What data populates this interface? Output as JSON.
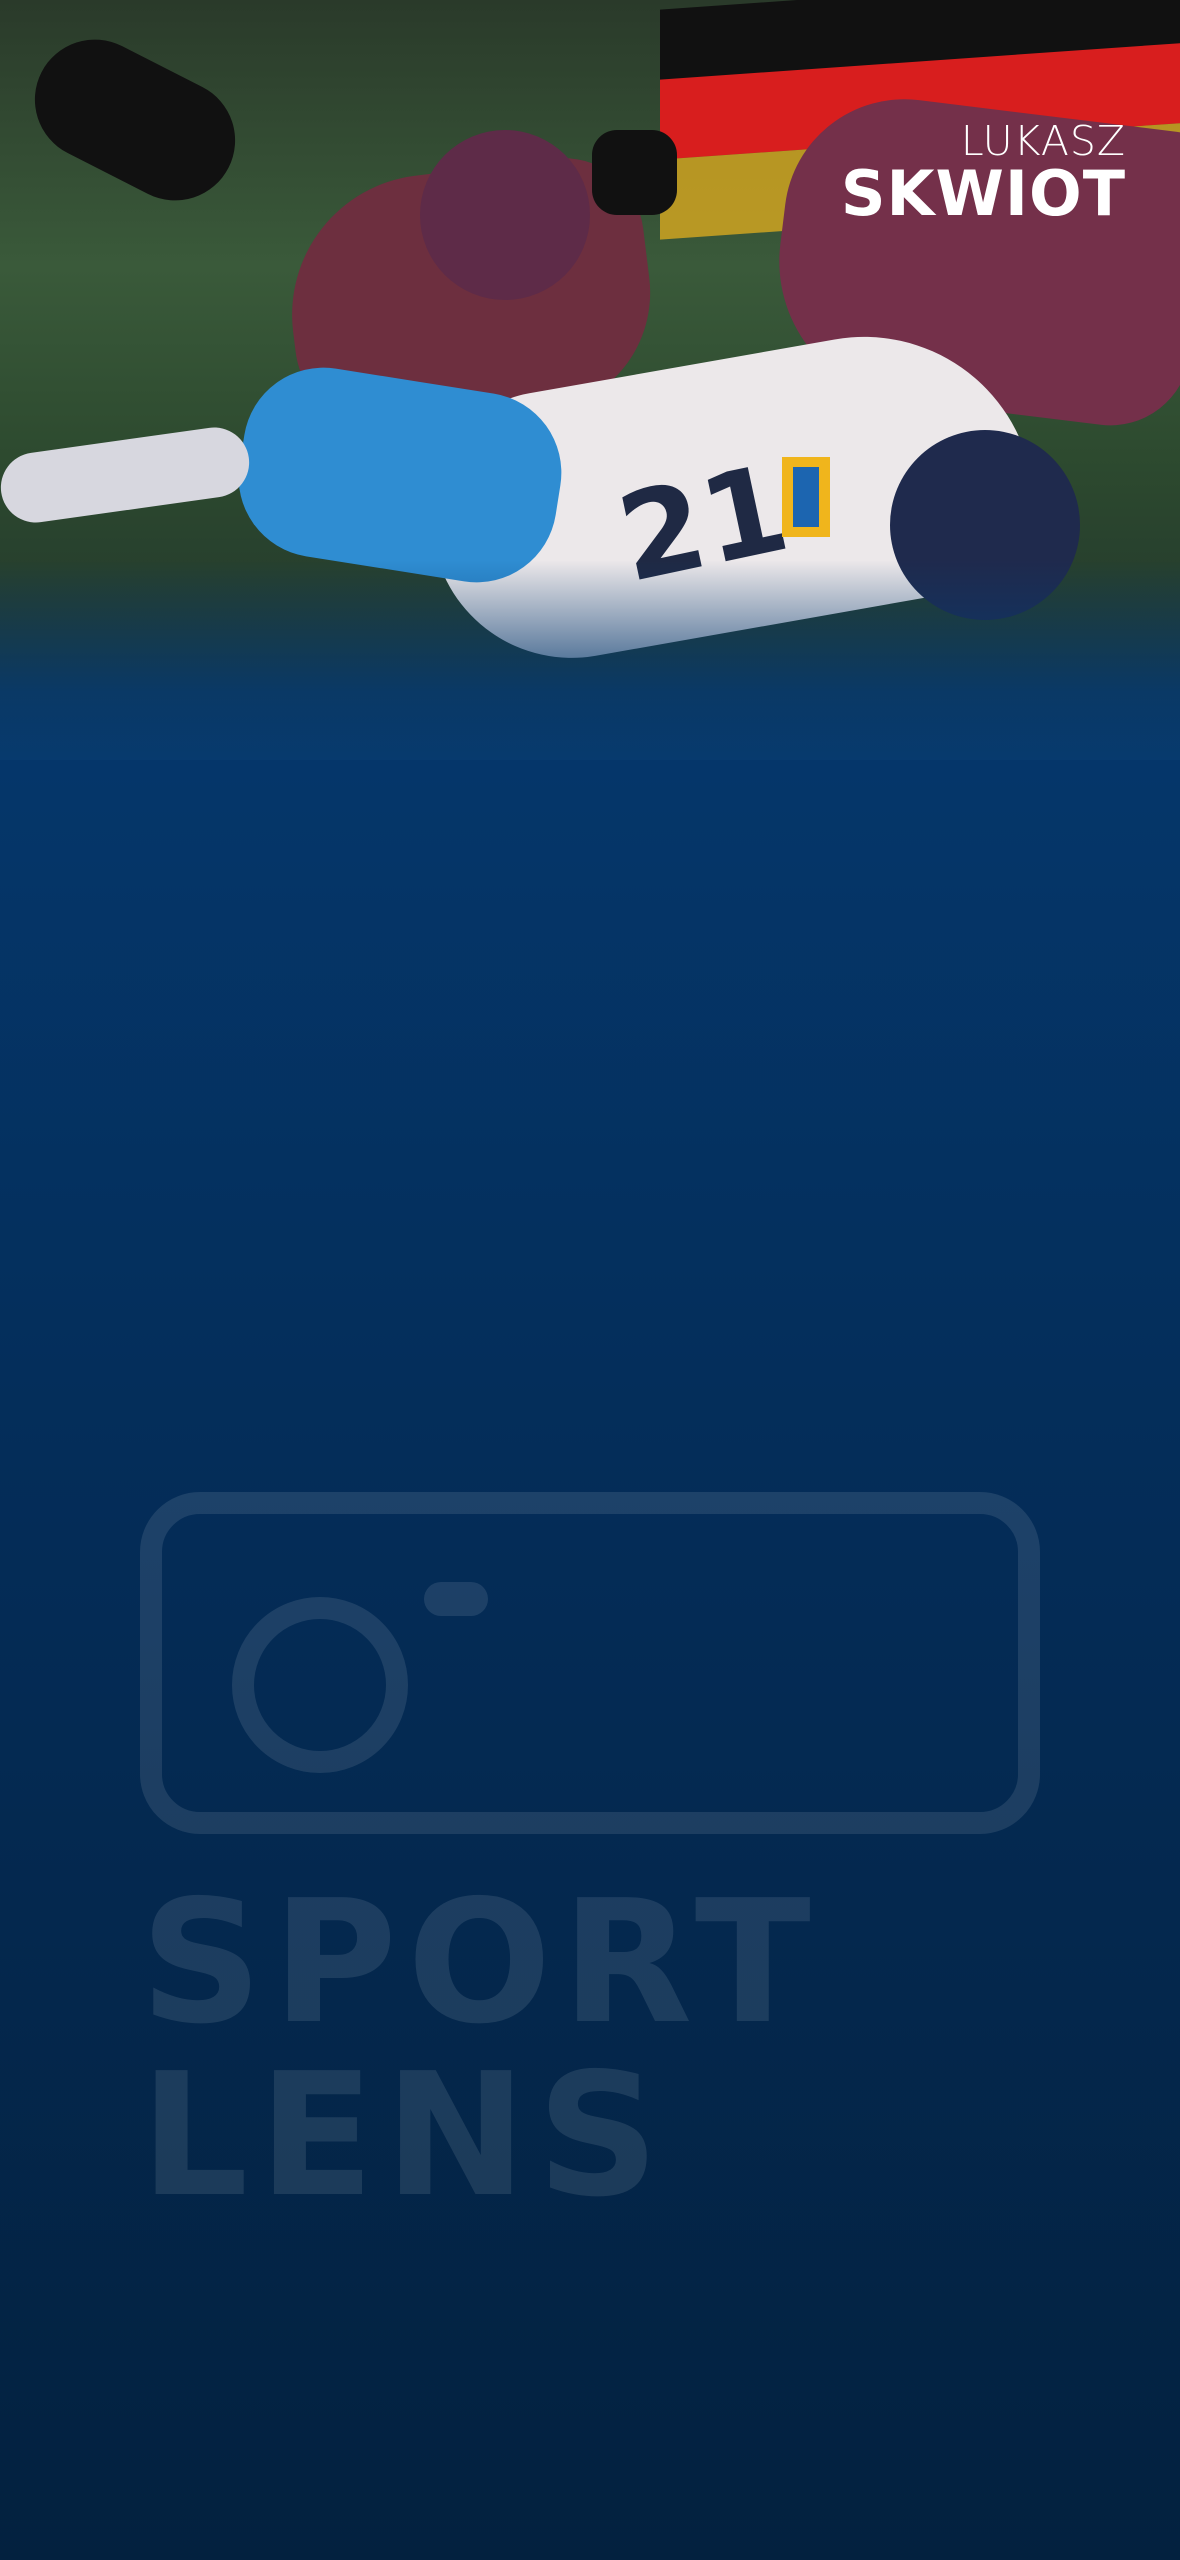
{
  "player": {
    "first_name": "LUKASZ",
    "last_name": "SKWIOT"
  },
  "jersey": {
    "number": "21"
  },
  "watermark": {
    "brand_line_1": "SPORT",
    "brand_line_2": "LENS"
  },
  "colors": {
    "background_top": "#063a70",
    "background_bottom": "#03213f",
    "flag_black": "#111111",
    "flag_red": "#d81e1e",
    "flag_gold": "#f0b51c"
  },
  "icons": {
    "camera": "camera-icon"
  }
}
